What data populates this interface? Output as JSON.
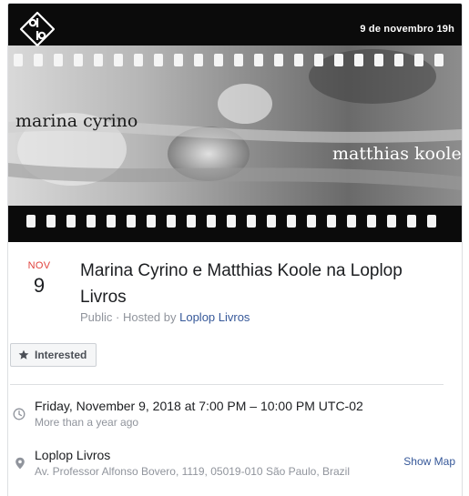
{
  "cover": {
    "date_time": "9 de novembro   19h",
    "artist_left": "marina cyrino",
    "artist_right": "matthias koole"
  },
  "event": {
    "month": "NOV",
    "day": "9",
    "title": "Marina Cyrino e Matthias Koole na Loplop Livros",
    "visibility": "Public · Hosted by ",
    "host": "Loplop Livros"
  },
  "actions": {
    "interested_label": "Interested"
  },
  "details": {
    "time": "Friday, November 9, 2018 at 7:00 PM – 10:00 PM UTC-02",
    "time_relative": "More than a year ago",
    "location_name": "Loplop Livros",
    "location_address": "Av. Professor Alfonso Bovero, 1119, 05019-010 São Paulo, Brazil",
    "map_link": "Show Map"
  },
  "colors": {
    "month": "#e1423d",
    "link": "#365899",
    "muted": "#90949c"
  },
  "icons": {
    "logo": "loplop-logo",
    "interested": "star-icon",
    "time": "clock-icon",
    "location": "pin-icon"
  }
}
